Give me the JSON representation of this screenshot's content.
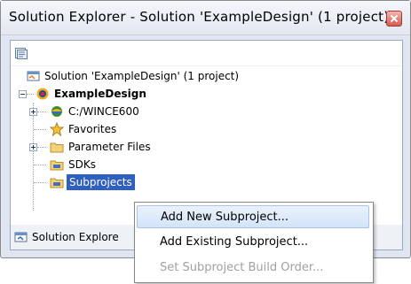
{
  "window": {
    "title": "Solution Explorer - Solution 'ExampleDesign' (1 project)"
  },
  "tree": {
    "solution_label": "Solution 'ExampleDesign' (1 project)",
    "project_label": "ExampleDesign",
    "items": [
      {
        "label": "C:/WINCE600"
      },
      {
        "label": "Favorites"
      },
      {
        "label": "Parameter Files"
      },
      {
        "label": "SDKs"
      },
      {
        "label": "Subprojects"
      }
    ]
  },
  "bottom_tab": {
    "label": "Solution Explore"
  },
  "context_menu": {
    "items": [
      {
        "label": "Add New Subproject...",
        "state": "hover"
      },
      {
        "label": "Add Existing Subproject...",
        "state": "normal"
      },
      {
        "label": "Set Subproject Build Order...",
        "state": "disabled"
      }
    ]
  },
  "colors": {
    "selection": "#2f5fbf",
    "menu_hover": "#d3e4f9"
  },
  "icons": {
    "toolbar": "properties-icon",
    "solution": "solution-icon",
    "project": "project-icon",
    "wince": "wince-icon",
    "favorites": "star-icon",
    "folder": "folder-icon"
  }
}
